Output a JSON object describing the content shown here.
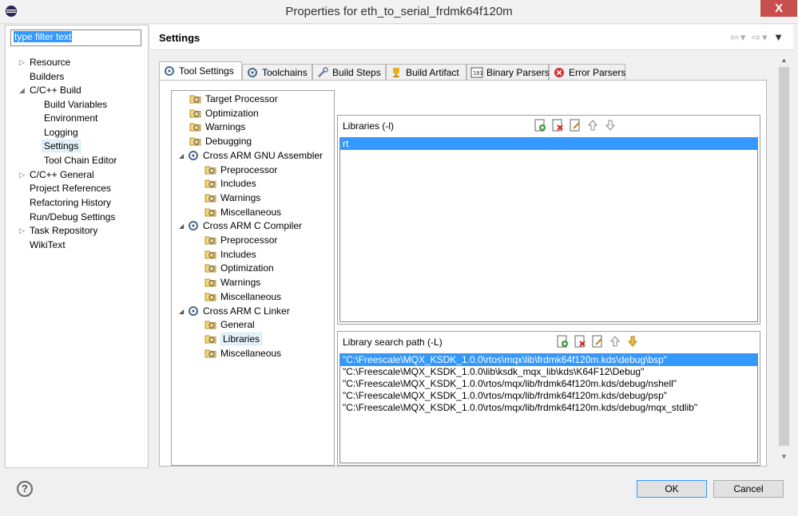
{
  "window": {
    "title": "Properties for eth_to_serial_frdmk64f120m",
    "close_glyph": "X"
  },
  "filter": {
    "placeholder": "type filter text"
  },
  "nav_items": [
    {
      "label": "Resource",
      "expandable": true
    },
    {
      "label": "Builders",
      "expandable": false
    },
    {
      "label": "C/C++ Build",
      "expandable": true,
      "expanded": true
    },
    {
      "label": "Build Variables",
      "expandable": false
    },
    {
      "label": "Environment",
      "expandable": false
    },
    {
      "label": "Logging",
      "expandable": false
    },
    {
      "label": "Settings",
      "expandable": false,
      "selected": true
    },
    {
      "label": "Tool Chain Editor",
      "expandable": false
    },
    {
      "label": "C/C++ General",
      "expandable": true
    },
    {
      "label": "Project References",
      "expandable": false
    },
    {
      "label": "Refactoring History",
      "expandable": false
    },
    {
      "label": "Run/Debug Settings",
      "expandable": false
    },
    {
      "label": "Task Repository",
      "expandable": true
    },
    {
      "label": "WikiText",
      "expandable": false
    }
  ],
  "page": {
    "title": "Settings"
  },
  "tabs": [
    {
      "label": "Tool Settings",
      "icon": "gear-icon",
      "active": true
    },
    {
      "label": "Toolchains",
      "icon": "gear-icon"
    },
    {
      "label": "Build Steps",
      "icon": "wrench-icon"
    },
    {
      "label": "Build Artifact",
      "icon": "trophy-icon"
    },
    {
      "label": "Binary Parsers",
      "icon": "binary-icon"
    },
    {
      "label": "Error Parsers",
      "icon": "error-icon"
    }
  ],
  "tool_tree": [
    {
      "label": "Target Processor",
      "level": 0
    },
    {
      "label": "Optimization",
      "level": 0
    },
    {
      "label": "Warnings",
      "level": 0
    },
    {
      "label": "Debugging",
      "level": 0
    },
    {
      "label": "Cross ARM GNU Assembler",
      "level": 0,
      "tool": true
    },
    {
      "label": "Preprocessor",
      "level": 1
    },
    {
      "label": "Includes",
      "level": 1
    },
    {
      "label": "Warnings",
      "level": 1
    },
    {
      "label": "Miscellaneous",
      "level": 1
    },
    {
      "label": "Cross ARM C Compiler",
      "level": 0,
      "tool": true
    },
    {
      "label": "Preprocessor",
      "level": 1
    },
    {
      "label": "Includes",
      "level": 1
    },
    {
      "label": "Optimization",
      "level": 1
    },
    {
      "label": "Warnings",
      "level": 1
    },
    {
      "label": "Miscellaneous",
      "level": 1
    },
    {
      "label": "Cross ARM C Linker",
      "level": 0,
      "tool": true
    },
    {
      "label": "General",
      "level": 1
    },
    {
      "label": "Libraries",
      "level": 1,
      "selected": true
    },
    {
      "label": "Miscellaneous",
      "level": 1
    }
  ],
  "libraries": {
    "title": "Libraries (-l)",
    "items": [
      "rt"
    ]
  },
  "library_search_path": {
    "title": "Library search path (-L)",
    "items": [
      "\"C:\\Freescale\\MQX_KSDK_1.0.0\\rtos\\mqx\\lib\\frdmk64f120m.kds\\debug\\bsp\"",
      "\"C:\\Freescale\\MQX_KSDK_1.0.0\\lib\\ksdk_mqx_lib\\kds\\K64F12\\Debug\"",
      "\"C:\\Freescale\\MQX_KSDK_1.0.0\\rtos/mqx/lib/frdmk64f120m.kds/debug/nshell\"",
      "\"C:\\Freescale\\MQX_KSDK_1.0.0\\rtos/mqx/lib/frdmk64f120m.kds/debug/psp\"",
      "\"C:\\Freescale\\MQX_KSDK_1.0.0\\rtos/mqx/lib/frdmk64f120m.kds/debug/mqx_stdlib\""
    ]
  },
  "buttons": {
    "ok": "OK",
    "cancel": "Cancel",
    "help": "?"
  },
  "colors": {
    "selection": "#3399ff",
    "close": "#c7504e"
  }
}
